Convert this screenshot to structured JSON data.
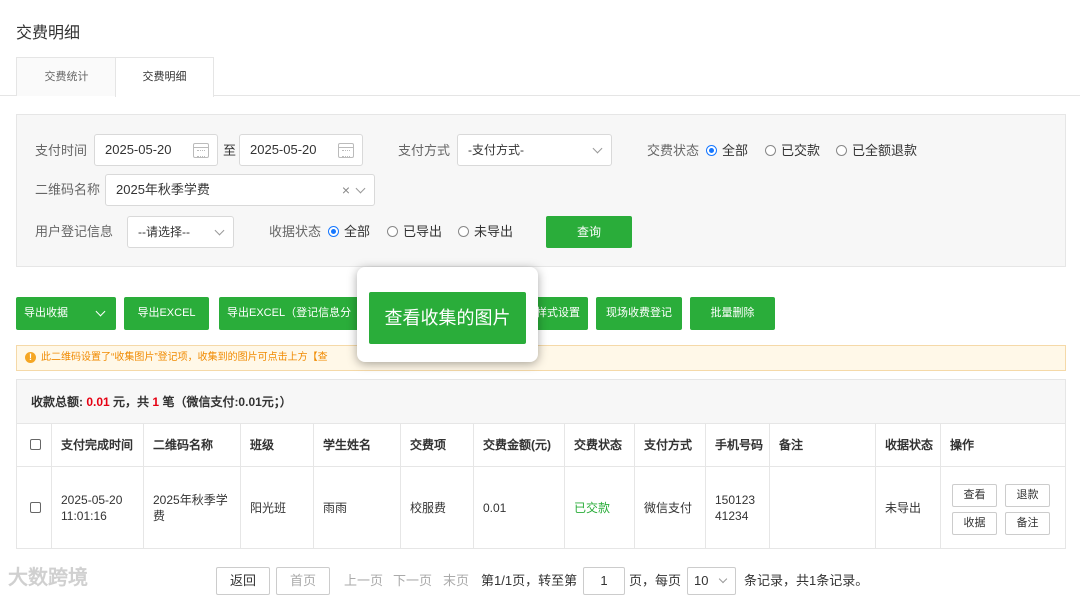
{
  "page": {
    "title": "交费明细"
  },
  "tabs": [
    {
      "label": "交费统计"
    },
    {
      "label": "交费明细"
    }
  ],
  "filters": {
    "pay_time_label": "支付时间",
    "date_from": "2025-05-20",
    "to_label": "至",
    "date_to": "2025-05-20",
    "pay_method_label": "支付方式",
    "pay_method_value": "-支付方式-",
    "status_label": "交费状态",
    "status_options": [
      "全部",
      "已交款",
      "已全额退款"
    ],
    "qrcode_label": "二维码名称",
    "qrcode_value": "2025年秋季学费",
    "user_info_label": "用户登记信息",
    "user_info_value": "--请选择--",
    "receipt_label": "收据状态",
    "receipt_options": [
      "全部",
      "已导出",
      "未导出"
    ],
    "query_button": "查询"
  },
  "toolbar": {
    "export_receipt": "导出收据",
    "export_excel": "导出EXCEL",
    "export_excel_reg": "导出EXCEL（登记信息分",
    "style_settings": "样式设置",
    "onsite_register": "现场收费登记",
    "batch_delete": "批量删除"
  },
  "popup": {
    "label": "查看收集的图片"
  },
  "notice": {
    "text": "此二维码设置了“收集图片”登记项，收集到的图片可点击上方【查"
  },
  "summary": {
    "prefix": "收款总额:",
    "amount": "0.01",
    "mid": "元，共",
    "count": "1",
    "suffix": "笔（微信支付:0.01元；）"
  },
  "table": {
    "headers": [
      "支付完成时间",
      "二维码名称",
      "班级",
      "学生姓名",
      "交费项",
      "交费金额(元)",
      "交费状态",
      "支付方式",
      "手机号码",
      "备注",
      "收据状态",
      "操作"
    ],
    "row": {
      "time": "2025-05-20 11:01:16",
      "qrcode": "2025年秋季学费",
      "class": "阳光班",
      "student": "雨雨",
      "item": "校服费",
      "amount": "0.01",
      "status": "已交款",
      "method": "微信支付",
      "phone": "15012341234",
      "remark": "",
      "receipt": "未导出",
      "ops": [
        "查看",
        "退款",
        "收据",
        "备注"
      ]
    }
  },
  "pagination": {
    "back": "返回",
    "first": "首页",
    "prev": "上一页",
    "next": "下一页",
    "last": "末页",
    "page_info": "第1/1页，转至第",
    "page_input": "1",
    "page_unit": "页，每页",
    "page_size": "10",
    "records": "条记录，共1条记录。"
  },
  "watermark": {
    "text": "大数跨境"
  },
  "colors": {
    "green": "#2aad3a",
    "red": "#e60012",
    "orange": "#f08a00",
    "blue": "#1677ff"
  }
}
